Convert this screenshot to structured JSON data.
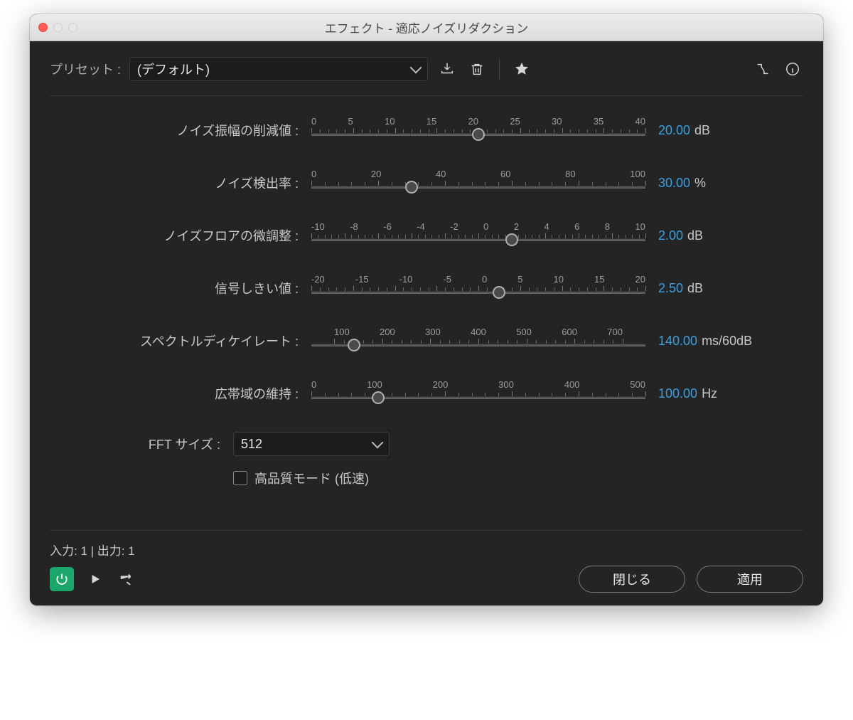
{
  "window": {
    "title": "エフェクト - 適応ノイズリダクション"
  },
  "preset": {
    "label": "プリセット :",
    "value": "(デフォルト)"
  },
  "params": [
    {
      "id": "reduce",
      "label": "ノイズ振幅の削減値 :",
      "ticks": [
        "0",
        "5",
        "10",
        "15",
        "20",
        "25",
        "30",
        "35",
        "40"
      ],
      "min": 0,
      "max": 40,
      "value": 20,
      "display": "20.00",
      "unit": "dB"
    },
    {
      "id": "noisiness",
      "label": "ノイズ検出率 :",
      "ticks": [
        "0",
        "20",
        "40",
        "60",
        "80",
        "100"
      ],
      "min": 0,
      "max": 100,
      "value": 30,
      "display": "30.00",
      "unit": "%"
    },
    {
      "id": "finetune",
      "label": "ノイズフロアの微調整 :",
      "ticks": [
        "-10",
        "-8",
        "-6",
        "-4",
        "-2",
        "0",
        "2",
        "4",
        "6",
        "8",
        "10"
      ],
      "min": -10,
      "max": 10,
      "value": 2,
      "display": "2.00",
      "unit": "dB"
    },
    {
      "id": "threshold",
      "label": "信号しきい値 :",
      "ticks": [
        "-20",
        "-15",
        "-10",
        "-5",
        "0",
        "5",
        "10",
        "15",
        "20"
      ],
      "min": -20,
      "max": 20,
      "value": 2.5,
      "display": "2.50",
      "unit": "dB"
    },
    {
      "id": "decay",
      "label": "スペクトルディケイレート :",
      "ticks": [
        "100",
        "200",
        "300",
        "400",
        "500",
        "600",
        "700"
      ],
      "min": 50,
      "max": 750,
      "value": 140,
      "display": "140.00",
      "unit": "ms/60dB",
      "pad": true
    },
    {
      "id": "broadband",
      "label": "広帯域の維持 :",
      "ticks": [
        "0",
        "100",
        "200",
        "300",
        "400",
        "500"
      ],
      "min": 0,
      "max": 500,
      "value": 100,
      "display": "100.00",
      "unit": "Hz"
    }
  ],
  "fft": {
    "label": "FFT サイズ :",
    "value": "512"
  },
  "hq": {
    "label": "高品質モード (低速)",
    "checked": false
  },
  "io": {
    "text": "入力: 1 | 出力: 1"
  },
  "buttons": {
    "close": "閉じる",
    "apply": "適用"
  }
}
